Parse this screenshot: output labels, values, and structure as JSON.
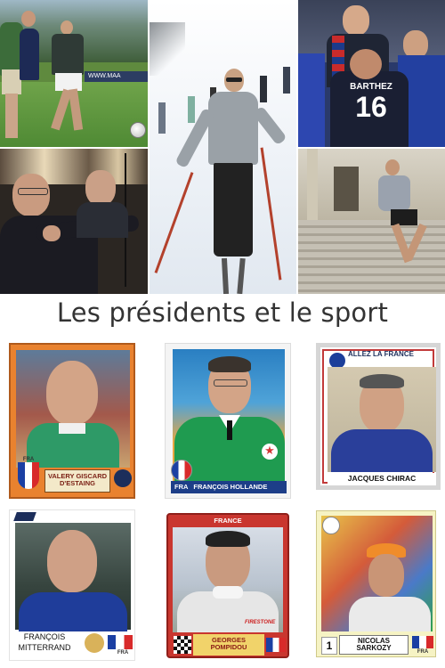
{
  "title": "Les présidents et le sport",
  "photos": {
    "football": {
      "board_text": "WWW.MAA",
      "shirt_number": ""
    },
    "golf": {},
    "jersey": {
      "shirt_name": "BARTHEZ",
      "shirt_number": "16"
    }
  },
  "stickers": {
    "giscard": {
      "name": "VALERY GISCARD D'ESTAING",
      "country": "FRA"
    },
    "hollande": {
      "name": "FRANÇOIS HOLLANDE",
      "country": "FRA"
    },
    "chirac": {
      "header": "ALLEZ LA FRANCE",
      "name": "JACQUES CHIRAC"
    },
    "mitterrand": {
      "name_line1": "FRANÇOIS",
      "name_line2": "MITTERRAND",
      "country": "FRA"
    },
    "pompidou": {
      "header": "FRANCE",
      "name_line1": "GEORGES",
      "name_line2": "POMPIDOU",
      "jacket_brand": "Firestone"
    },
    "sarkozy": {
      "number": "1",
      "name_line1": "NICOLAS",
      "name_line2": "SARKOZY",
      "country": "FRA"
    }
  }
}
